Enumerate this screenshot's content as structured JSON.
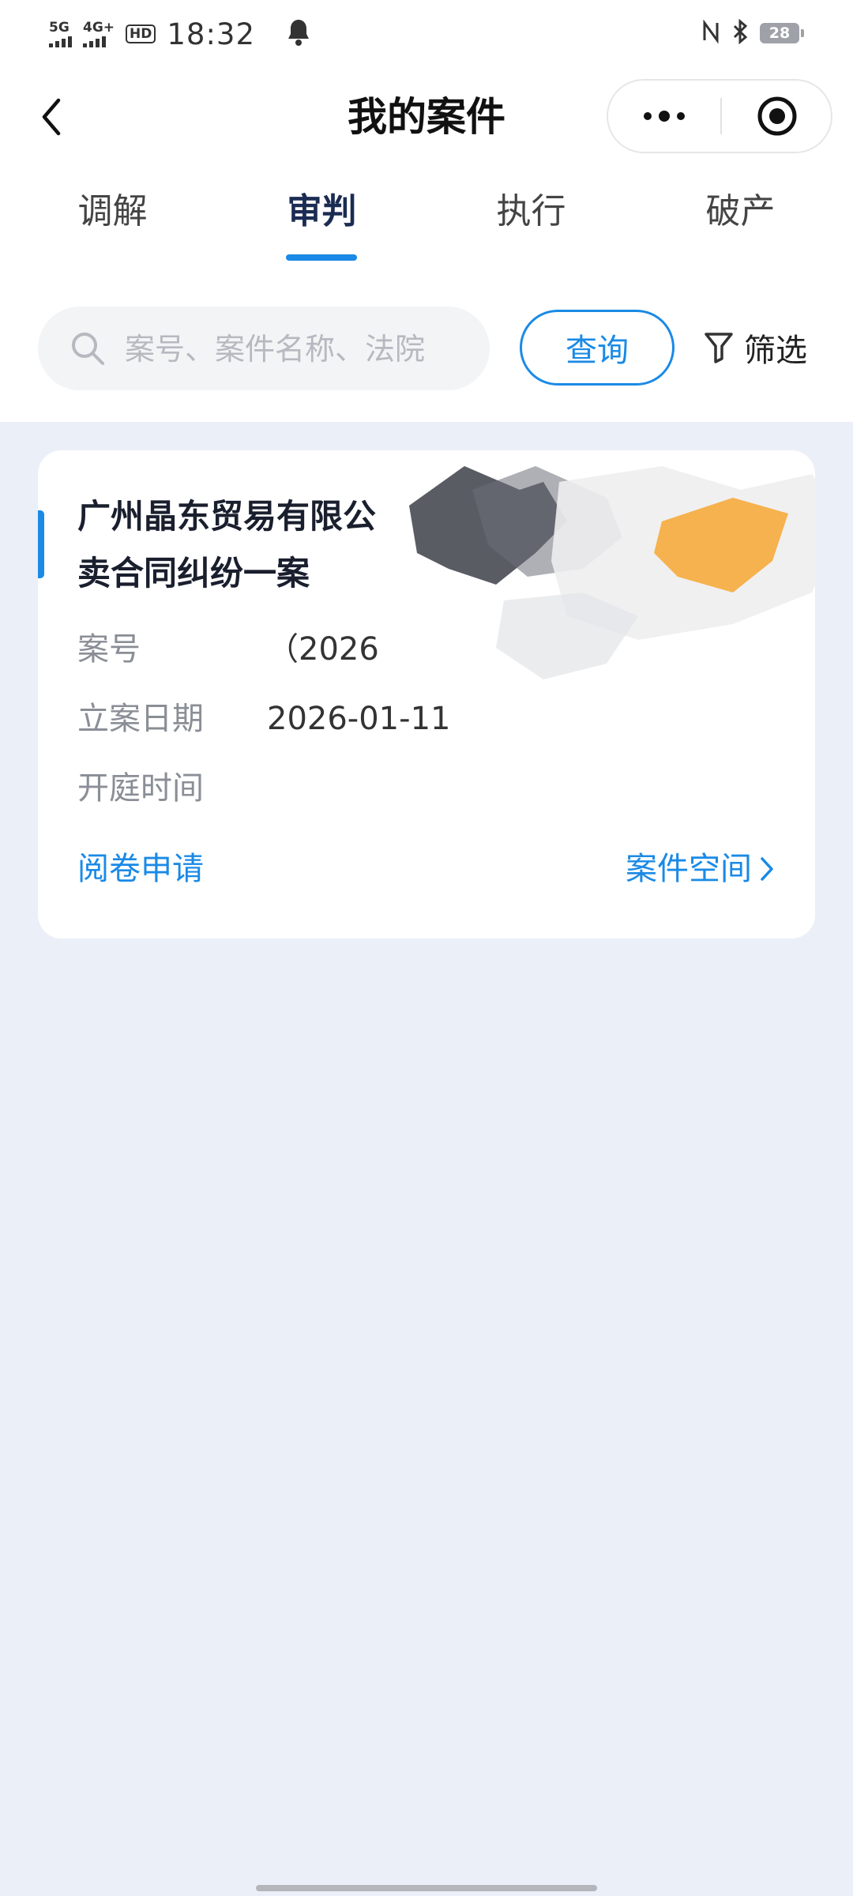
{
  "status_bar": {
    "network_1": "5G",
    "network_2": "4G+",
    "hd_badge": "HD",
    "time": "18:32",
    "battery_level": "28"
  },
  "nav": {
    "title": "我的案件"
  },
  "tabs": [
    {
      "label": "调解",
      "active": false
    },
    {
      "label": "审判",
      "active": true
    },
    {
      "label": "执行",
      "active": false
    },
    {
      "label": "破产",
      "active": false
    }
  ],
  "search": {
    "placeholder": "案号、案件名称、法院",
    "query_label": "查询",
    "filter_label": "筛选"
  },
  "case_card": {
    "title_line1": "广州晶东贸易有限公",
    "title_line2": "卖合同纠纷一案",
    "case_no_label": "案号",
    "case_no_value": "（2026",
    "filing_date_label": "立案日期",
    "filing_date_value": "2026-01-11",
    "hearing_time_label": "开庭时间",
    "hearing_time_value": "",
    "apply_review_label": "阅卷申请",
    "case_space_label": "案件空间"
  },
  "colors": {
    "accent": "#1a8ae6",
    "page_background": "#ebeff7",
    "tab_active": "#1b2c53"
  },
  "icons": [
    "back-arrow-icon",
    "more-dots-icon",
    "target-icon",
    "search-icon",
    "filter-funnel-icon",
    "chevron-right-icon",
    "notification-bell-icon",
    "nfc-icon",
    "bluetooth-icon"
  ]
}
